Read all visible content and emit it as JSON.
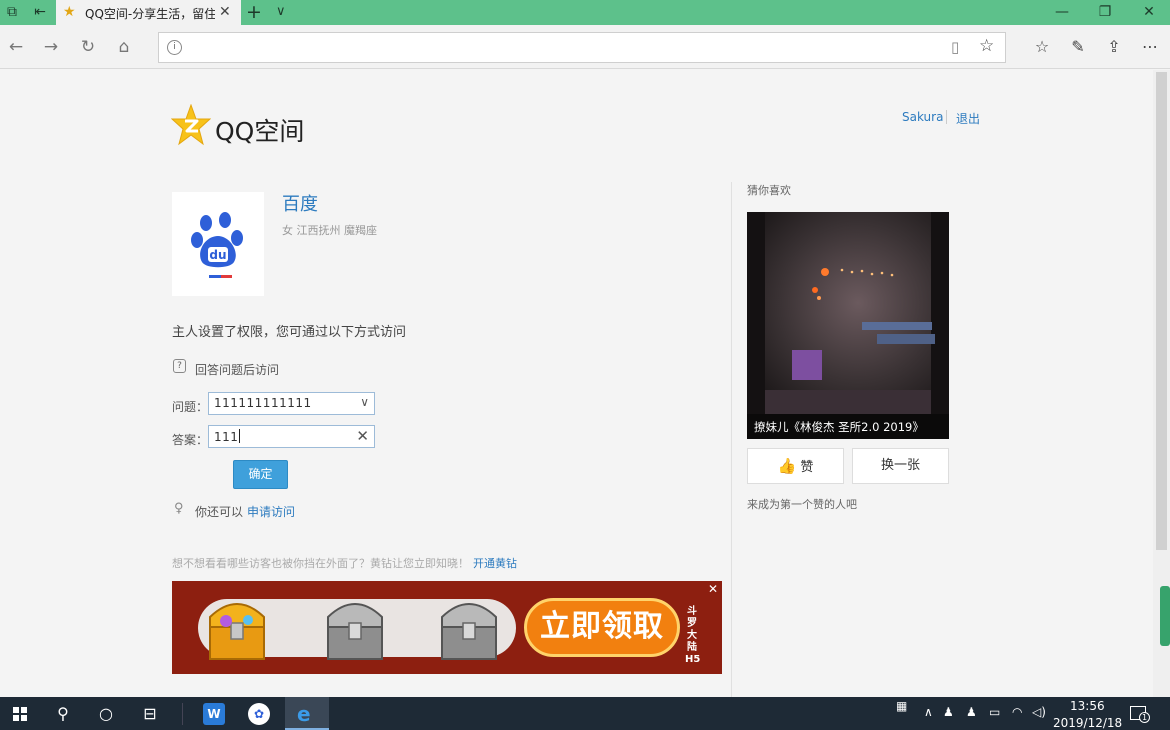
{
  "browser": {
    "tab_title": "QQ空间-分享生活，留住感动",
    "url": "",
    "accent_color": "#5dc18b"
  },
  "header": {
    "logo_text": "QQ空间",
    "username": "Sakura",
    "logout": "退出"
  },
  "profile": {
    "name": "百度",
    "info": "女 江西抚州 魔羯座",
    "avatar_brand_text": "du"
  },
  "access": {
    "notice": "主人设置了权限，您可通过以下方式访问",
    "method": "回答问题后访问",
    "question_label": "问题：",
    "question_value": "111111111111",
    "answer_label": "答案：",
    "answer_value": "111",
    "confirm_label": "确定",
    "also_text": "你还可以",
    "apply_link": "申请访问"
  },
  "promo": {
    "text": "想不想看看哪些访客也被你挡在外面了？黄钻让您立即知晓！",
    "link": "开通黄钻"
  },
  "banner": {
    "cta": "立即领取",
    "game_title": "斗罗大陆H5",
    "close": "✕"
  },
  "sidebar": {
    "title": "猜你喜欢",
    "photo_caption": "撩妹儿《林俊杰 圣所2.0 2019》",
    "like_label": "赞",
    "switch_label": "换一张",
    "first_like": "来成为第一个赞的人吧"
  },
  "taskbar": {
    "time": "13:56",
    "date": "2019/12/18",
    "notification_count": "1"
  }
}
